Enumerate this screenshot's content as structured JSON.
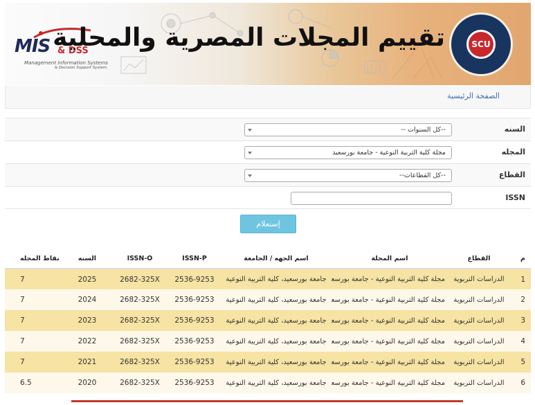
{
  "banner": {
    "title": "تقييم المجلات المصرية والمحلية",
    "mis_logo": {
      "main": "MIS",
      "amp": "& DSS",
      "line1": "Management Information Systems",
      "line2": "& Decision Support System"
    },
    "scu_logo": {
      "text": "SCU",
      "ring": "SUPREME COUNCIL OF UNIVERSITIES"
    }
  },
  "breadcrumb": {
    "home": "الصفحة الرئيسية"
  },
  "filters": {
    "year": {
      "label": "السنه",
      "value": "--كل السنوات --"
    },
    "journal": {
      "label": "المجله",
      "value": "مجلة كلية التربية النوعية - جامعة بورسعيد"
    },
    "sector": {
      "label": "القطاع",
      "value": "--كل القطاعات--"
    },
    "issn": {
      "label": "ISSN",
      "value": ""
    },
    "submit_label": "إستعلام"
  },
  "table": {
    "headers": {
      "index": "م",
      "sector": "القطاع",
      "journal": "اسم المجلة",
      "org": "اسم الجهه / الجامعة",
      "issn_p": "ISSN-P",
      "issn_o": "ISSN-O",
      "year": "السنه",
      "points": "نقاط المجله"
    },
    "rows": [
      {
        "index": "1",
        "sector": "الدراسات التربوية",
        "journal": "مجلة كلية التربية النوعية - جامعة بورسعيد",
        "org": "جامعة بورسعيد، كلية التربية النوعية",
        "issn_p": "2536-9253",
        "issn_o": "2682-325X",
        "year": "2025",
        "points": "7"
      },
      {
        "index": "2",
        "sector": "الدراسات التربوية",
        "journal": "مجلة كلية التربية النوعية - جامعة بورسعيد",
        "org": "جامعة بورسعيد، كلية التربية النوعية",
        "issn_p": "2536-9253",
        "issn_o": "2682-325X",
        "year": "2024",
        "points": "7"
      },
      {
        "index": "3",
        "sector": "الدراسات التربوية",
        "journal": "مجلة كلية التربية النوعية - جامعة بورسعيد",
        "org": "جامعة بورسعيد، كلية التربية النوعية",
        "issn_p": "2536-9253",
        "issn_o": "2682-325X",
        "year": "2023",
        "points": "7"
      },
      {
        "index": "4",
        "sector": "الدراسات التربوية",
        "journal": "مجلة كلية التربية النوعية - جامعة بورسعيد",
        "org": "جامعة بورسعيد، كلية التربية النوعية",
        "issn_p": "2536-9253",
        "issn_o": "2682-325X",
        "year": "2022",
        "points": "7"
      },
      {
        "index": "5",
        "sector": "الدراسات التربوية",
        "journal": "مجلة كلية التربية النوعية - جامعة بورسعيد",
        "org": "جامعة بورسعيد، كلية التربية النوعية",
        "issn_p": "2536-9253",
        "issn_o": "2682-325X",
        "year": "2021",
        "points": "7"
      },
      {
        "index": "6",
        "sector": "الدراسات التربوية",
        "journal": "مجلة كلية التربية النوعية - جامعة بورسعيد",
        "org": "جامعة بورسعيد، كلية التربية النوعية",
        "issn_p": "2536-9253",
        "issn_o": "2682-325X",
        "year": "2020",
        "points": "6.5"
      }
    ]
  },
  "colors": {
    "row_odd": "#f7e3a3",
    "row_even": "#fdf8ea",
    "button": "#6fc4e0",
    "link": "#3b6fb6",
    "accent_red": "#c0392b"
  }
}
